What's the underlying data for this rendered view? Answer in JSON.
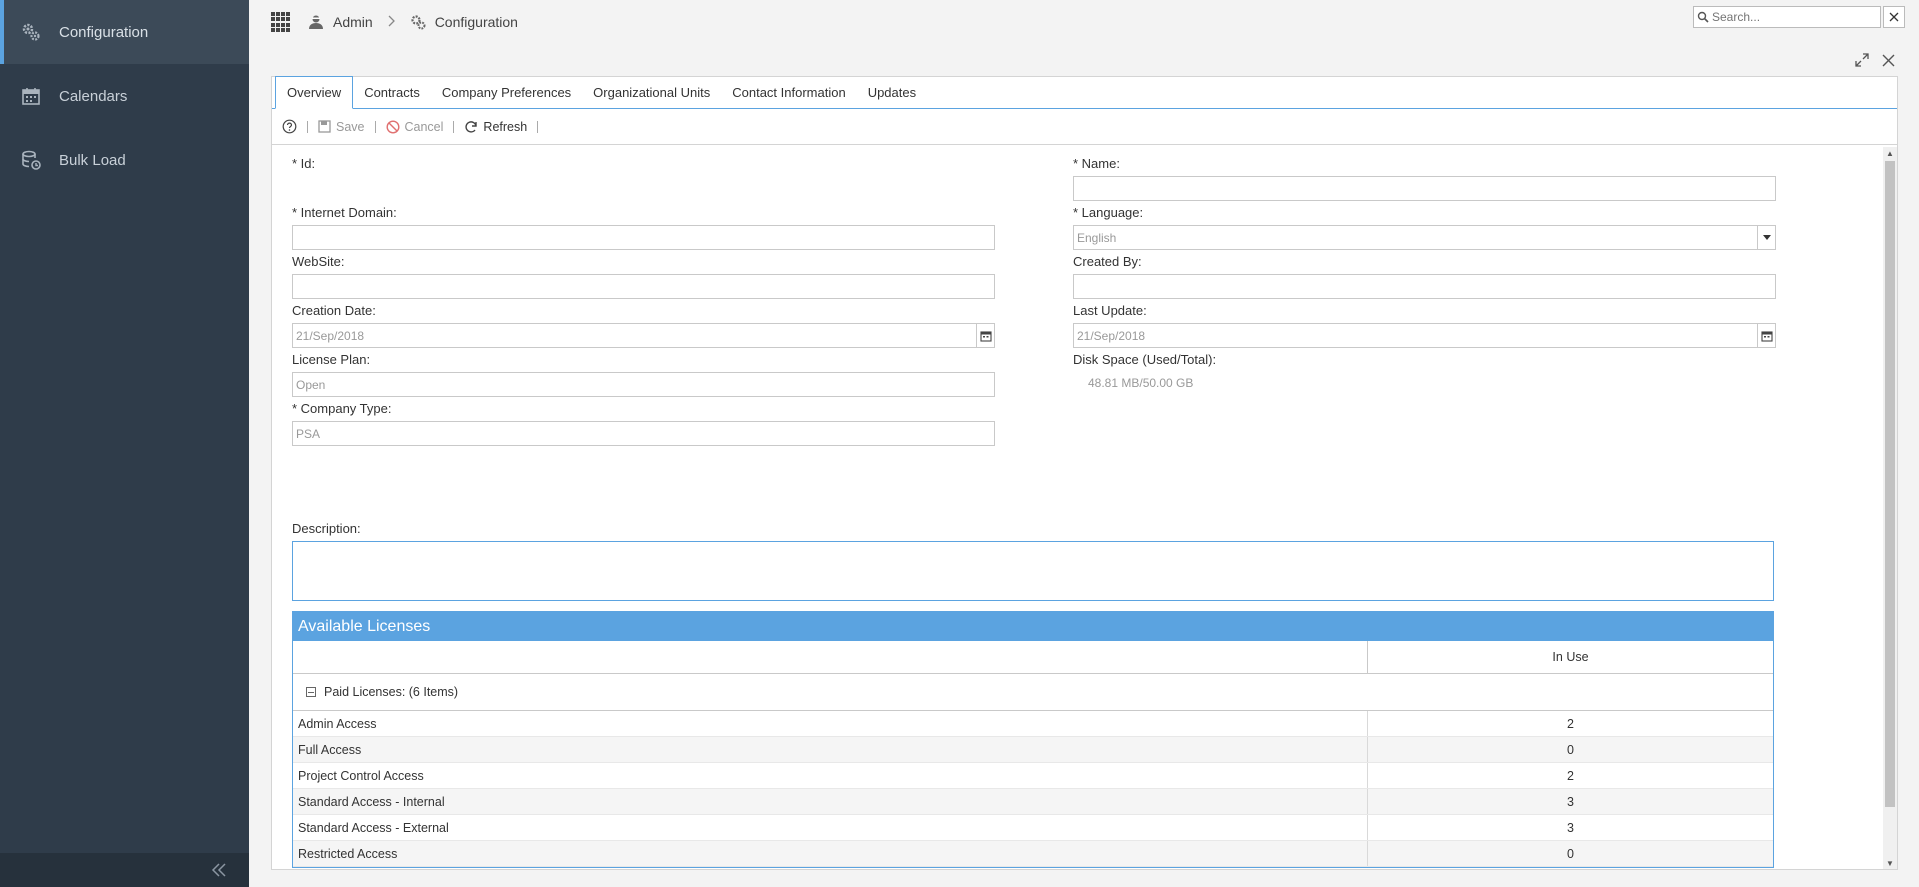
{
  "sidebar": {
    "items": [
      {
        "label": "Configuration",
        "icon": "gear-config-icon",
        "active": true
      },
      {
        "label": "Calendars",
        "icon": "calendar-icon",
        "active": false
      },
      {
        "label": "Bulk Load",
        "icon": "database-icon",
        "active": false
      }
    ]
  },
  "breadcrumb": {
    "admin": "Admin",
    "configuration": "Configuration"
  },
  "search": {
    "placeholder": "Search..."
  },
  "tabs": [
    "Overview",
    "Contracts",
    "Company Preferences",
    "Organizational Units",
    "Contact Information",
    "Updates"
  ],
  "toolbar": {
    "save": "Save",
    "cancel": "Cancel",
    "refresh": "Refresh"
  },
  "form": {
    "id_label": "* Id:",
    "name_label": "* Name:",
    "name_value": "",
    "internet_domain_label": "* Internet Domain:",
    "internet_domain_value": "",
    "language_label": "* Language:",
    "language_value": "English",
    "website_label": "WebSite:",
    "website_value": "",
    "created_by_label": "Created By:",
    "created_by_value": "",
    "creation_date_label": "Creation Date:",
    "creation_date_value": "21/Sep/2018",
    "last_update_label": "Last Update:",
    "last_update_value": "21/Sep/2018",
    "license_plan_label": "License Plan:",
    "license_plan_value": "Open",
    "disk_space_label": "Disk Space (Used/Total):",
    "disk_space_value": "48.81 MB/50.00 GB",
    "company_type_label": "* Company Type:",
    "company_type_value": "PSA",
    "description_label": "Description:"
  },
  "licenses": {
    "title": "Available Licenses",
    "col_in_use": "In Use",
    "group_label": "Paid Licenses: (6 Items)",
    "rows": [
      {
        "name": "Admin Access",
        "in_use": "2"
      },
      {
        "name": "Full Access",
        "in_use": "0"
      },
      {
        "name": "Project Control Access",
        "in_use": "2"
      },
      {
        "name": "Standard Access - Internal",
        "in_use": "3"
      },
      {
        "name": "Standard Access - External",
        "in_use": "3"
      },
      {
        "name": "Restricted Access",
        "in_use": "0"
      }
    ]
  },
  "colors": {
    "accent": "#5ba3e0",
    "sidebar": "#2f3c4a"
  }
}
